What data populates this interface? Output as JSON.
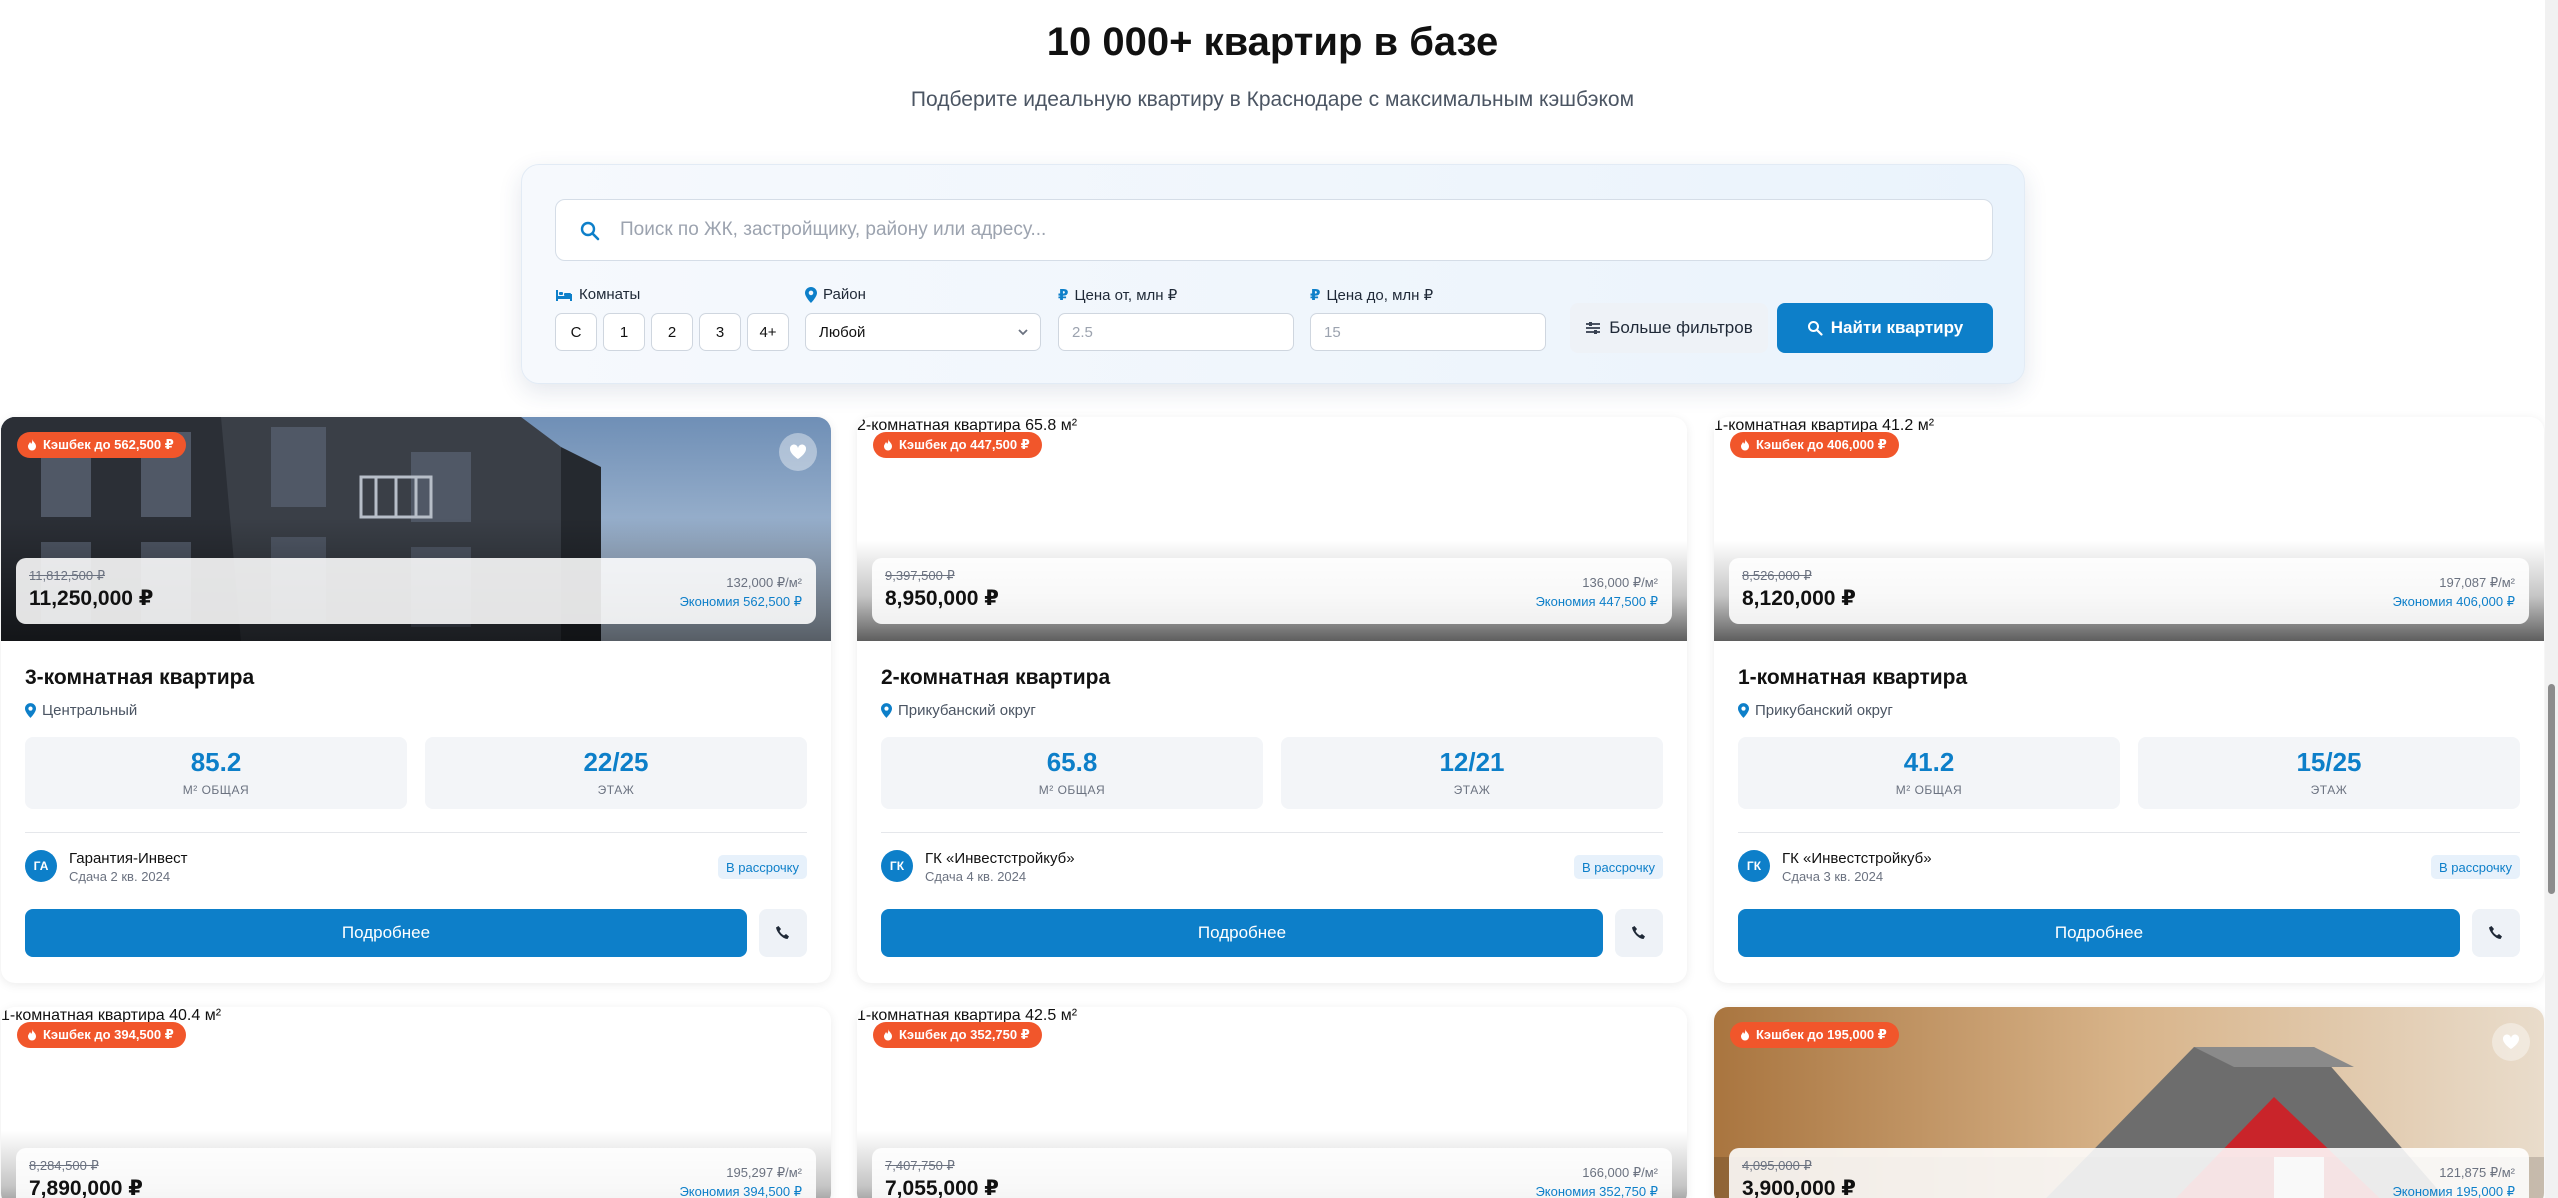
{
  "header": {
    "title": "10 000+ квартир в базе",
    "subtitle": "Подберите идеальную квартиру в Краснодаре с максимальным кэшбэком"
  },
  "search": {
    "placeholder": "Поиск по ЖК, застройщику, району или адресу...",
    "rooms_label": "Комнаты",
    "room_options": [
      "С",
      "1",
      "2",
      "3",
      "4+"
    ],
    "district_label": "Район",
    "district_value": "Любой",
    "price_from_label": "Цена от, млн ₽",
    "price_from_placeholder": "2.5",
    "price_to_label": "Цена до, млн ₽",
    "price_to_placeholder": "15",
    "more_filters_label": "Больше фильтров",
    "find_label": "Найти квартиру"
  },
  "accent_color": "#0d7fc9",
  "cashback_color": "#f1562b",
  "listings": [
    {
      "image_alt": "",
      "photo": "building-photo",
      "cashback": "Кэшбек до 562,500 ₽",
      "old_price": "11,812,500 ₽",
      "price": "11,250,000 ₽",
      "price_per_m2": "132,000 ₽/м²",
      "savings": "Экономия 562,500 ₽",
      "title": "3-комнатная квартира",
      "district": "Центральный",
      "area": "85.2",
      "area_label": "М² ОБЩАЯ",
      "floor": "22/25",
      "floor_label": "ЭТАЖ",
      "developer_initials": "ГА",
      "developer": "Гарантия-Инвест",
      "delivery": "Сдача 2 кв. 2024",
      "installment": "В рассрочку",
      "details_label": "Подробнее"
    },
    {
      "image_alt": "2-комнатная квартира 65.8 м²",
      "cashback": "Кэшбек до 447,500 ₽",
      "old_price": "9,397,500 ₽",
      "price": "8,950,000 ₽",
      "price_per_m2": "136,000 ₽/м²",
      "savings": "Экономия 447,500 ₽",
      "title": "2-комнатная квартира",
      "district": "Прикубанский округ",
      "area": "65.8",
      "area_label": "М² ОБЩАЯ",
      "floor": "12/21",
      "floor_label": "ЭТАЖ",
      "developer_initials": "ГК",
      "developer": "ГК «Инвестстройкуб»",
      "delivery": "Сдача 4 кв. 2024",
      "installment": "В рассрочку",
      "details_label": "Подробнее"
    },
    {
      "image_alt": "1-комнатная квартира 41.2 м²",
      "cashback": "Кэшбек до 406,000 ₽",
      "old_price": "8,526,000 ₽",
      "price": "8,120,000 ₽",
      "price_per_m2": "197,087 ₽/м²",
      "savings": "Экономия 406,000 ₽",
      "title": "1-комнатная квартира",
      "district": "Прикубанский округ",
      "area": "41.2",
      "area_label": "М² ОБЩАЯ",
      "floor": "15/25",
      "floor_label": "ЭТАЖ",
      "developer_initials": "ГК",
      "developer": "ГК «Инвестстройкуб»",
      "delivery": "Сдача 3 кв. 2024",
      "installment": "В рассрочку",
      "details_label": "Подробнее"
    },
    {
      "image_alt": "1-комнатная квартира 40.4 м²",
      "cashback": "Кэшбек до 394,500 ₽",
      "old_price": "8,284,500 ₽",
      "price": "7,890,000 ₽",
      "price_per_m2": "195,297 ₽/м²",
      "savings": "Экономия 394,500 ₽"
    },
    {
      "image_alt": "1-комнатная квартира 42.5 м²",
      "cashback": "Кэшбек до 352,750 ₽",
      "old_price": "7,407,750 ₽",
      "price": "7,055,000 ₽",
      "price_per_m2": "166,000 ₽/м²",
      "savings": "Экономия 352,750 ₽"
    },
    {
      "image_alt": "",
      "photo": "house-photo",
      "cashback": "Кэшбек до 195,000 ₽",
      "old_price": "4,095,000 ₽",
      "price": "3,900,000 ₽",
      "price_per_m2": "121,875 ₽/м²",
      "savings": "Экономия 195,000 ₽"
    }
  ]
}
